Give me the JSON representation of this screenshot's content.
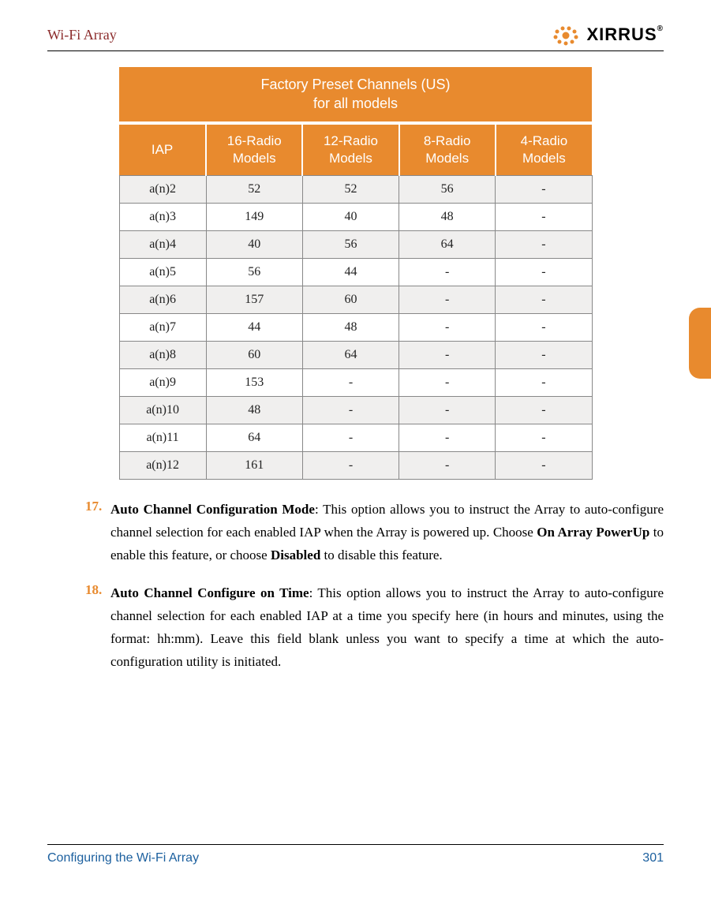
{
  "header": {
    "title": "Wi-Fi Array",
    "logo_text": "XIRRUS",
    "logo_mark": "®"
  },
  "table": {
    "title_line1": "Factory Preset Channels (US)",
    "title_line2": "for all models",
    "columns": {
      "c0": "IAP",
      "c1a": "16-Radio",
      "c1b": "Models",
      "c2a": "12-Radio",
      "c2b": "Models",
      "c3a": "8-Radio",
      "c3b": "Models",
      "c4a": "4-Radio",
      "c4b": "Models"
    },
    "rows": [
      {
        "iap": "a(n)2",
        "r16": "52",
        "r12": "52",
        "r8": "56",
        "r4": "-"
      },
      {
        "iap": "a(n)3",
        "r16": "149",
        "r12": "40",
        "r8": "48",
        "r4": "-"
      },
      {
        "iap": "a(n)4",
        "r16": "40",
        "r12": "56",
        "r8": "64",
        "r4": "-"
      },
      {
        "iap": "a(n)5",
        "r16": "56",
        "r12": "44",
        "r8": "-",
        "r4": "-"
      },
      {
        "iap": "a(n)6",
        "r16": "157",
        "r12": "60",
        "r8": "-",
        "r4": "-"
      },
      {
        "iap": "a(n)7",
        "r16": "44",
        "r12": "48",
        "r8": "-",
        "r4": "-"
      },
      {
        "iap": "a(n)8",
        "r16": "60",
        "r12": "64",
        "r8": "-",
        "r4": "-"
      },
      {
        "iap": "a(n)9",
        "r16": "153",
        "r12": "-",
        "r8": "-",
        "r4": "-"
      },
      {
        "iap": "a(n)10",
        "r16": "48",
        "r12": "-",
        "r8": "-",
        "r4": "-"
      },
      {
        "iap": "a(n)11",
        "r16": "64",
        "r12": "-",
        "r8": "-",
        "r4": "-"
      },
      {
        "iap": "a(n)12",
        "r16": "161",
        "r12": "-",
        "r8": "-",
        "r4": "-"
      }
    ]
  },
  "items": {
    "n17": "17.",
    "t17a": "Auto Channel Configuration Mode",
    "t17b": ": This option allows you to instruct the Array to auto-configure channel selection for each enabled IAP when the Array is powered up. Choose ",
    "t17c": "On Array PowerUp",
    "t17d": " to enable this feature, or choose ",
    "t17e": "Disabled",
    "t17f": " to disable this feature.",
    "n18": "18.",
    "t18a": "Auto Channel Configure on Time",
    "t18b": ": This option allows you to instruct the Array to auto-configure channel selection for each enabled IAP at a time you specify here (in hours and minutes, using the format: hh:mm). Leave this field blank unless you want to specify a time at which the auto-configuration utility is initiated."
  },
  "footer": {
    "section": "Configuring the Wi-Fi Array",
    "page": "301"
  }
}
